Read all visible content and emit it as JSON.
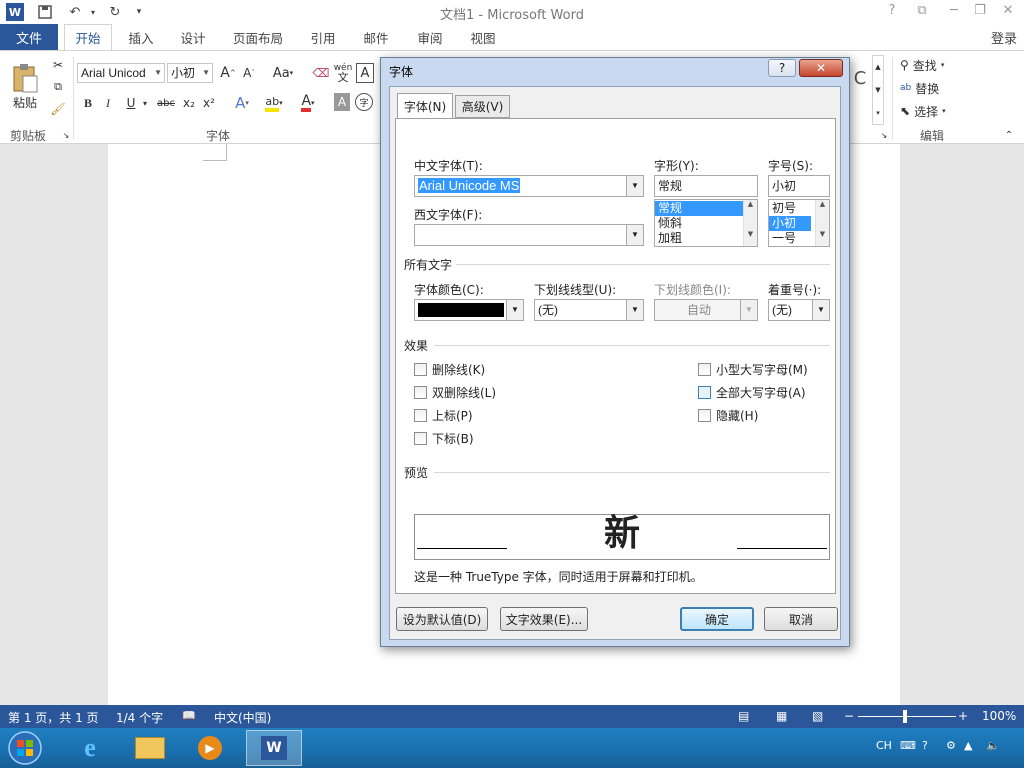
{
  "window": {
    "title": "文档1 - Microsoft Word",
    "login": "登录",
    "controls": [
      "?",
      "⧉",
      "─",
      "❐",
      "✕"
    ]
  },
  "ribbon_tabs": [
    "文件",
    "开始",
    "插入",
    "设计",
    "页面布局",
    "引用",
    "邮件",
    "审阅",
    "视图"
  ],
  "ribbon": {
    "paste_label": "粘贴",
    "font_name": "Arial Unicod",
    "font_size": "小初",
    "grow_font": "A",
    "shrink_font": "A",
    "change_case": "Aa",
    "pinyin": "wén",
    "char_border": "A",
    "bold": "B",
    "italic": "I",
    "underline": "U",
    "strike": "abc",
    "subscript": "x₂",
    "superscript": "x²",
    "text_effects": "A",
    "highlight": "ab",
    "font_color": "A",
    "char_shade": "A",
    "enclose": "字",
    "find": "查找",
    "replace": "替换",
    "select": "选择",
    "groups": {
      "clipboard": "剪贴板",
      "font": "字体",
      "editing": "编辑"
    }
  },
  "dialog": {
    "title": "字体",
    "help": "?",
    "close": "✕",
    "tabs": [
      "字体(N)",
      "高级(V)"
    ],
    "cn_font_label": "中文字体(T):",
    "cn_font_value": "Arial Unicode MS",
    "west_font_label": "西文字体(F):",
    "west_font_value": "",
    "style_label": "字形(Y):",
    "style_value": "常规",
    "style_options": [
      "常规",
      "倾斜",
      "加粗"
    ],
    "size_label": "字号(S):",
    "size_value": "小初",
    "size_options": [
      "初号",
      "小初",
      "一号"
    ],
    "all_text_header": "所有文字",
    "font_color_label": "字体颜色(C):",
    "underline_style_label": "下划线线型(U):",
    "underline_style_value": "(无)",
    "underline_color_label": "下划线颜色(I):",
    "underline_color_value": "自动",
    "emphasis_label": "着重号(·):",
    "emphasis_value": "(无)",
    "effects_header": "效果",
    "effects_left": [
      "删除线(K)",
      "双删除线(L)",
      "上标(P)",
      "下标(B)"
    ],
    "effects_right": [
      "小型大写字母(M)",
      "全部大写字母(A)",
      "隐藏(H)"
    ],
    "preview_header": "预览",
    "preview_text": "新",
    "preview_note": "这是一种 TrueType 字体，同时适用于屏幕和打印机。",
    "btn_default": "设为默认值(D)",
    "btn_effects": "文字效果(E)...",
    "btn_ok": "确定",
    "btn_cancel": "取消"
  },
  "statusbar": {
    "page": "第 1 页，共 1 页",
    "words": "1/4 个字",
    "language": "中文(中国)",
    "zoom": "100%"
  },
  "taskbar": {
    "tray_lang": "CH"
  },
  "colors": {
    "accent": "#2b579a",
    "font_color_swatch": "#000000"
  }
}
